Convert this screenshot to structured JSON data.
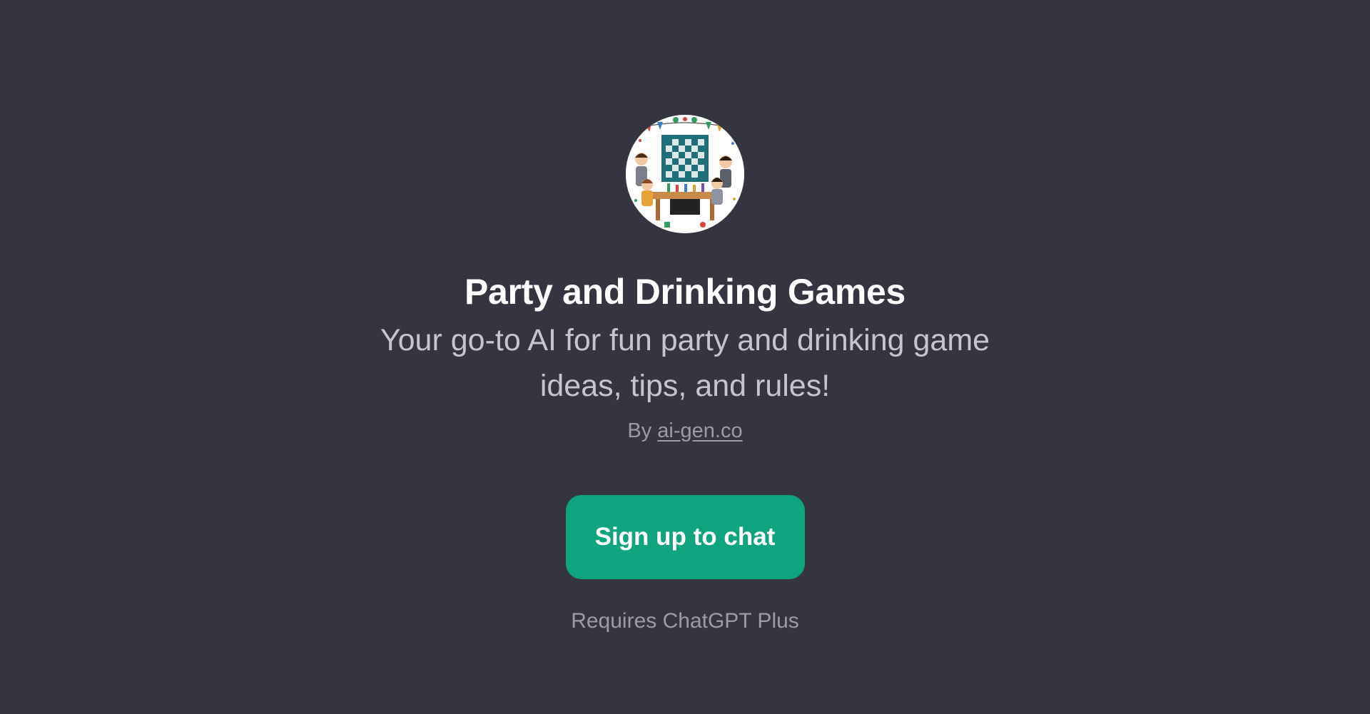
{
  "gpt": {
    "avatar_icon": "party-games-illustration",
    "title": "Party and Drinking Games",
    "description": "Your go-to AI for fun party and drinking game ideas, tips, and rules!",
    "byline_prefix": "By",
    "author": "ai-gen.co"
  },
  "actions": {
    "signup_label": "Sign up to chat",
    "requirement_note": "Requires ChatGPT Plus"
  },
  "colors": {
    "background": "#343541",
    "accent": "#10a37f",
    "title": "#ffffff",
    "muted": "#9c9ca8"
  }
}
